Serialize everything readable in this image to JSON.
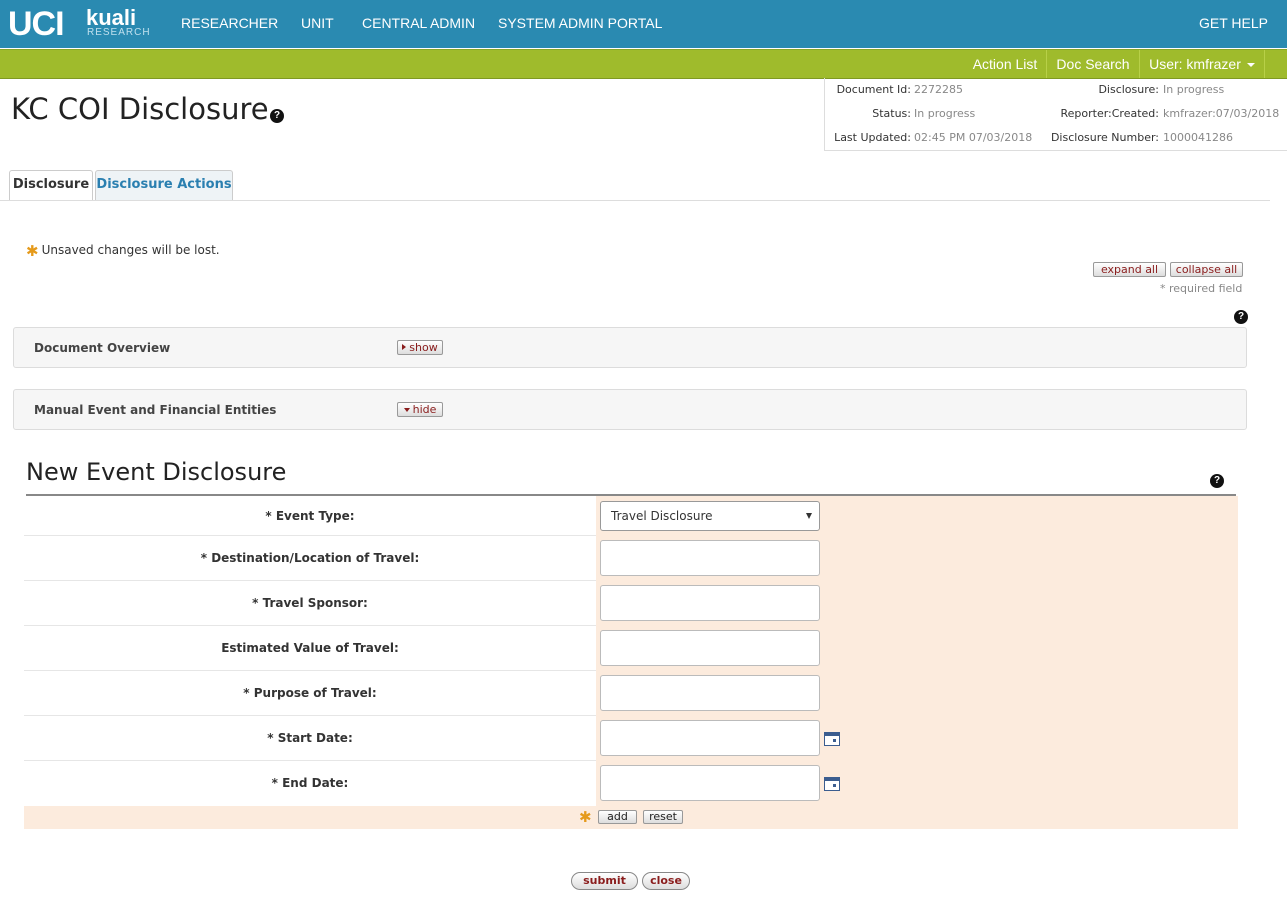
{
  "header": {
    "logo": {
      "uci": "UCI",
      "kuali": "kuali",
      "research": "RESEARCH"
    },
    "nav": [
      "RESEARCHER",
      "UNIT",
      "CENTRAL ADMIN",
      "SYSTEM ADMIN PORTAL"
    ],
    "get_help": "GET HELP",
    "bar_color": "#2a8ab1"
  },
  "subnav": {
    "action_list": "Action List",
    "doc_search": "Doc Search",
    "user": "User: kmfrazer",
    "bar_color": "#9fbb2c"
  },
  "doc_info": {
    "document_id_label": "Document Id:",
    "document_id": "2272285",
    "disclosure_label": "Disclosure:",
    "disclosure": "In progress",
    "status_label": "Status:",
    "status": "In progress",
    "reporter_label": "Reporter:Created:",
    "reporter": "kmfrazer:07/03/2018",
    "last_updated_label": "Last Updated:",
    "last_updated": "02:45 PM 07/03/2018",
    "disclosure_number_label": "Disclosure Number:",
    "disclosure_number": "1000041286"
  },
  "page": {
    "title": "KC COI Disclosure"
  },
  "tabs": [
    {
      "label": "Disclosure",
      "active": true
    },
    {
      "label": "Disclosure Actions",
      "active": false
    }
  ],
  "notice": {
    "unsaved": "Unsaved changes will be lost."
  },
  "controls": {
    "expand_all": "expand all",
    "collapse_all": "collapse all",
    "required_note": "* required field"
  },
  "panels": [
    {
      "title": "Document Overview",
      "toggle": "show"
    },
    {
      "title": "Manual Event and Financial Entities",
      "toggle": "hide"
    }
  ],
  "event_form": {
    "title": "New Event Disclosure",
    "event_type_label": "*  Event Type:",
    "event_type_value": "Travel Disclosure",
    "fields": [
      {
        "label": "* Destination/Location of Travel:",
        "value": ""
      },
      {
        "label": "* Travel Sponsor:",
        "value": ""
      },
      {
        "label": "Estimated Value of Travel:",
        "value": ""
      },
      {
        "label": "* Purpose of Travel:",
        "value": ""
      },
      {
        "label": "* Start Date:",
        "value": ""
      },
      {
        "label": "* End Date:",
        "value": ""
      }
    ],
    "add": "add",
    "reset": "reset",
    "background": "#fcebdd"
  },
  "actions": {
    "submit": "submit",
    "close": "close"
  },
  "icons": {
    "help": "help-icon",
    "required_star": "asterisk-icon",
    "calendar": "calendar-icon"
  }
}
